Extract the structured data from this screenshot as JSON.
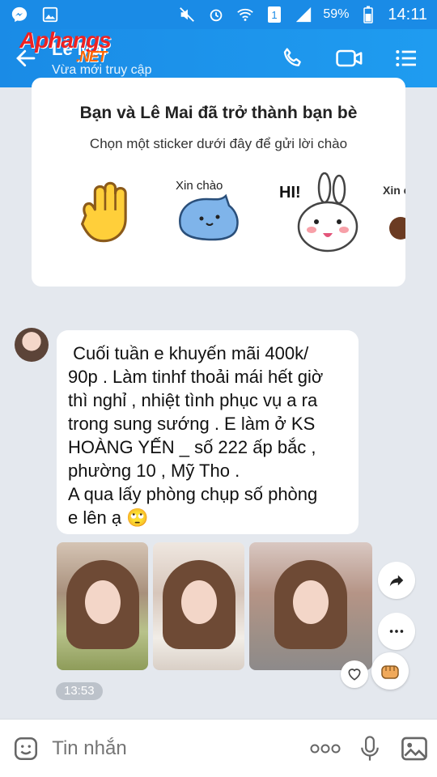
{
  "status_bar": {
    "battery": "59%",
    "time": "14:11",
    "sim": "1"
  },
  "header": {
    "name": "Lê Mai",
    "presence": "Vừa mới truy cập",
    "watermark": "Aphangs",
    "watermark_suffix": ".NET"
  },
  "friend_card": {
    "title": "Bạn và Lê Mai đã trở thành bạn bè",
    "subtitle": "Chọn một sticker dưới đây để gửi lời chào",
    "sticker_texts": [
      "Xin chào",
      "HI!",
      "Xin chào"
    ]
  },
  "message": {
    "text": " Cuối tuần e khuyến mãi 400k/\n90p . Làm tinhf thoải mái hết giờ\nthì nghỉ , nhiệt tình phục vụ a ra\ntrong sung sướng . E làm ở KS\nHOÀNG YẾN _ số 222 ấp bắc ,\nphường 10 , Mỹ Tho .\nA qua lấy phòng chụp số phòng\ne lên ạ 🙄",
    "timestamp": "13:53"
  },
  "input": {
    "placeholder": "Tin nhắn"
  },
  "colors": {
    "header": "#1a8be6",
    "background": "#e4e8ee"
  }
}
